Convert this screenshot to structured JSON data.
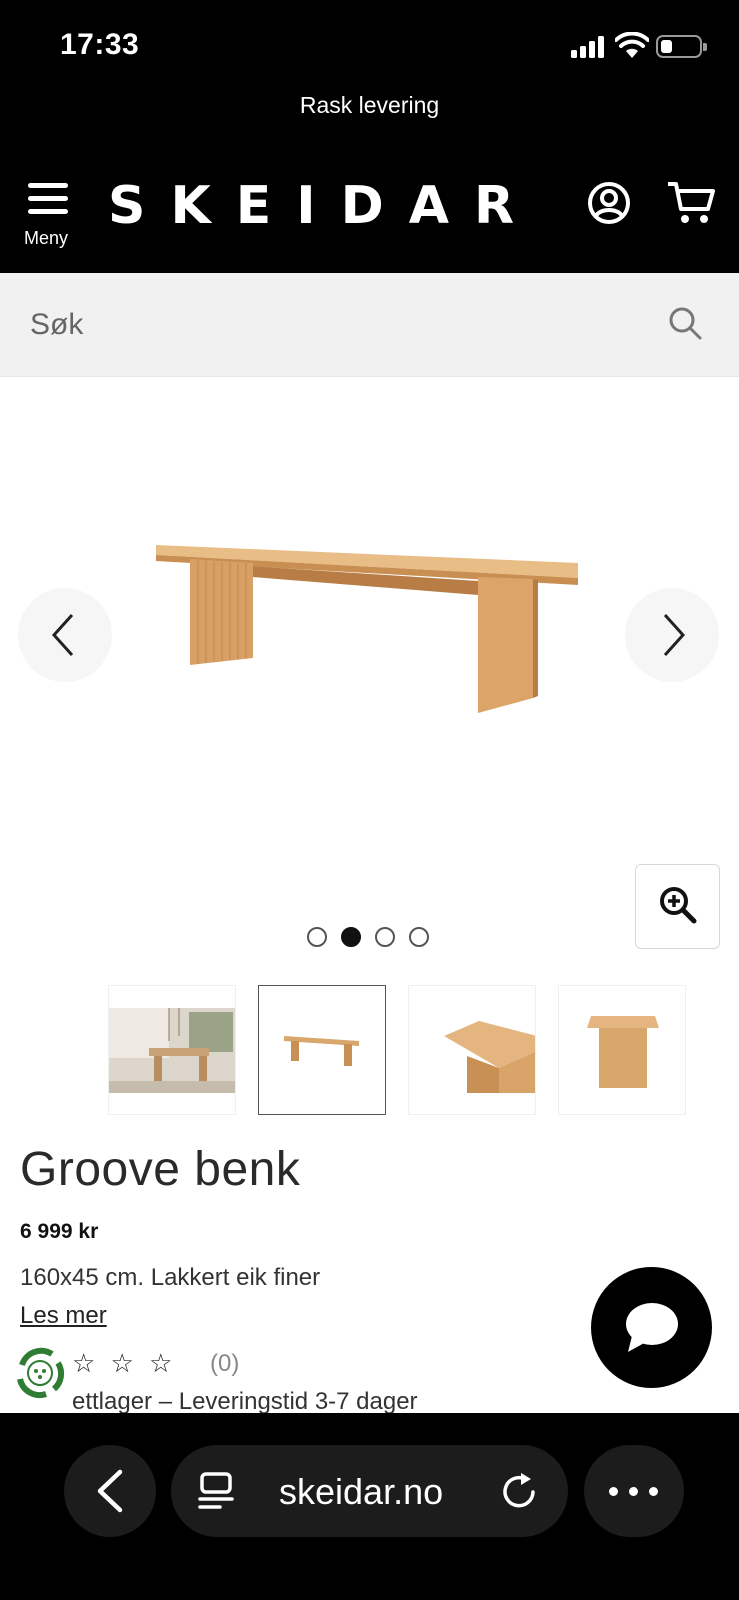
{
  "status_bar": {
    "time": "17:33"
  },
  "promo": {
    "text": "Rask levering"
  },
  "header": {
    "logo": "SKEIDAR",
    "menu_label": "Meny"
  },
  "search": {
    "placeholder": "Søk"
  },
  "gallery": {
    "image_count": 4,
    "active_index": 1
  },
  "product": {
    "title": "Groove benk",
    "price": "6 999 kr",
    "description": "160x45 cm. Lakkert eik finer",
    "read_more": "Les mer",
    "rating_stars": "☆ ☆ ☆",
    "review_count": "(0)",
    "stock": "ettlager – Leveringstid 3-7 dager"
  },
  "browser": {
    "domain": "skeidar.no"
  },
  "colors": {
    "header_bg": "#000000",
    "search_bg": "#f1f1f1",
    "wood": "#e0b27a"
  }
}
